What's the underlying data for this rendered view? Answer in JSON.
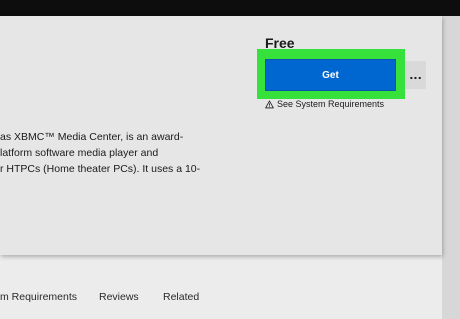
{
  "product": {
    "price": "Free",
    "get_label": "Get",
    "more_label": "...",
    "system_requirements_label": "See System Requirements",
    "description_lines": [
      "as XBMC™ Media Center, is an award-",
      "latform software media player and",
      "r HTPCs (Home theater PCs). It uses a 10-"
    ]
  },
  "tabs": [
    {
      "label": "m Requirements"
    },
    {
      "label": "Reviews"
    },
    {
      "label": "Related"
    }
  ],
  "colors": {
    "accent": "#0067d1",
    "highlight": "#35e13a",
    "top_bar": "#0d0d0d",
    "card": "#e6e6e6"
  },
  "icons": {
    "warning": "warning-icon",
    "more": "ellipsis-icon"
  }
}
